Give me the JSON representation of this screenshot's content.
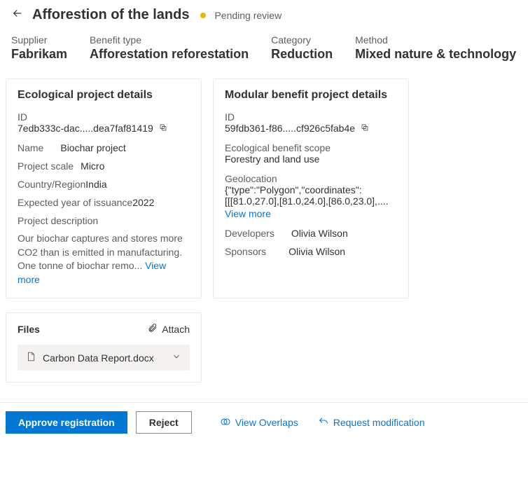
{
  "header": {
    "title": "Afforestion of the lands",
    "status": "Pending review"
  },
  "meta": {
    "supplier_label": "Supplier",
    "supplier_value": "Fabrikam",
    "benefit_type_label": "Benefit type",
    "benefit_type_value": "Afforestation reforestation",
    "category_label": "Category",
    "category_value": "Reduction",
    "method_label": "Method",
    "method_value": "Mixed nature & technology"
  },
  "ecological": {
    "title": "Ecological project details",
    "id_label": "ID",
    "id_value": "7edb333c-dac.....dea7faf81419",
    "name_label": "Name",
    "name_value": "Biochar project",
    "scale_label": "Project scale",
    "scale_value": "Micro",
    "country_label": "Country/Region",
    "country_value": "India",
    "year_label": "Expected year of issuance",
    "year_value": "2022",
    "desc_label": "Project description",
    "desc_value": "Our biochar captures and stores more CO2 than is emitted in manufacturing. One tonne of biochar remo...",
    "view_more": "View more"
  },
  "modular": {
    "title": "Modular benefit project details",
    "id_label": "ID",
    "id_value": "59fdb361-f86.....cf926c5fab4e",
    "scope_label": "Ecological benefit scope",
    "scope_value": "Forestry and land use",
    "geo_label": "Geolocation",
    "geo_value": "{\"type\":\"Polygon\",\"coordinates\":[[[81.0,27.0],[81.0,24.0],[86.0,23.0],....",
    "view_more": "View more",
    "dev_label": "Developers",
    "dev_value": "Olivia Wilson",
    "sponsor_label": "Sponsors",
    "sponsor_value": "Olivia Wilson"
  },
  "files": {
    "title": "Files",
    "attach": "Attach",
    "file_name": "Carbon Data Report.docx"
  },
  "footer": {
    "approve": "Approve registration",
    "reject": "Reject",
    "overlaps": "View Overlaps",
    "modify": "Request modification"
  }
}
